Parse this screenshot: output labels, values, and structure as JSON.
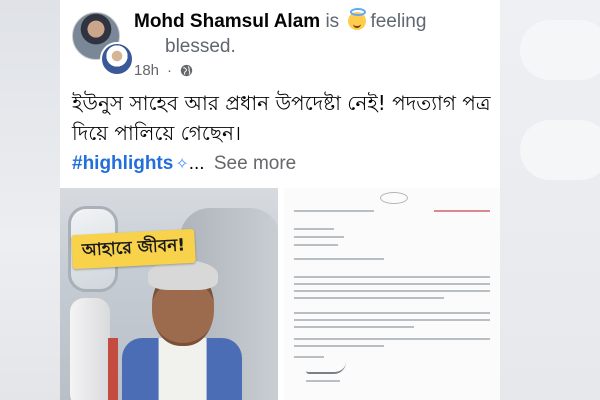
{
  "post": {
    "author_name": "Mohd Shamsul Alam",
    "status_is": "is",
    "feeling_word": "feeling",
    "feeling": "blessed.",
    "time": "18h",
    "text": "ইউনুস সাহেব আর প্রধান উপদেষ্টা নেই! পদত্যাগ পত্র দিয়ে পালিয়ে গেছেন।",
    "hashtag": "#highlights",
    "ellipsis": "...",
    "see_more": "See more"
  },
  "media": {
    "photo_caption": "আহারে জীবন!"
  },
  "colors": {
    "link_blue": "#216fdb",
    "muted_gray": "#65676b",
    "caption_yellow": "#f7d24a"
  },
  "icons": {
    "feeling": "halo-smiley-emoji",
    "privacy": "globe-icon",
    "sparkle": "sparkle"
  }
}
